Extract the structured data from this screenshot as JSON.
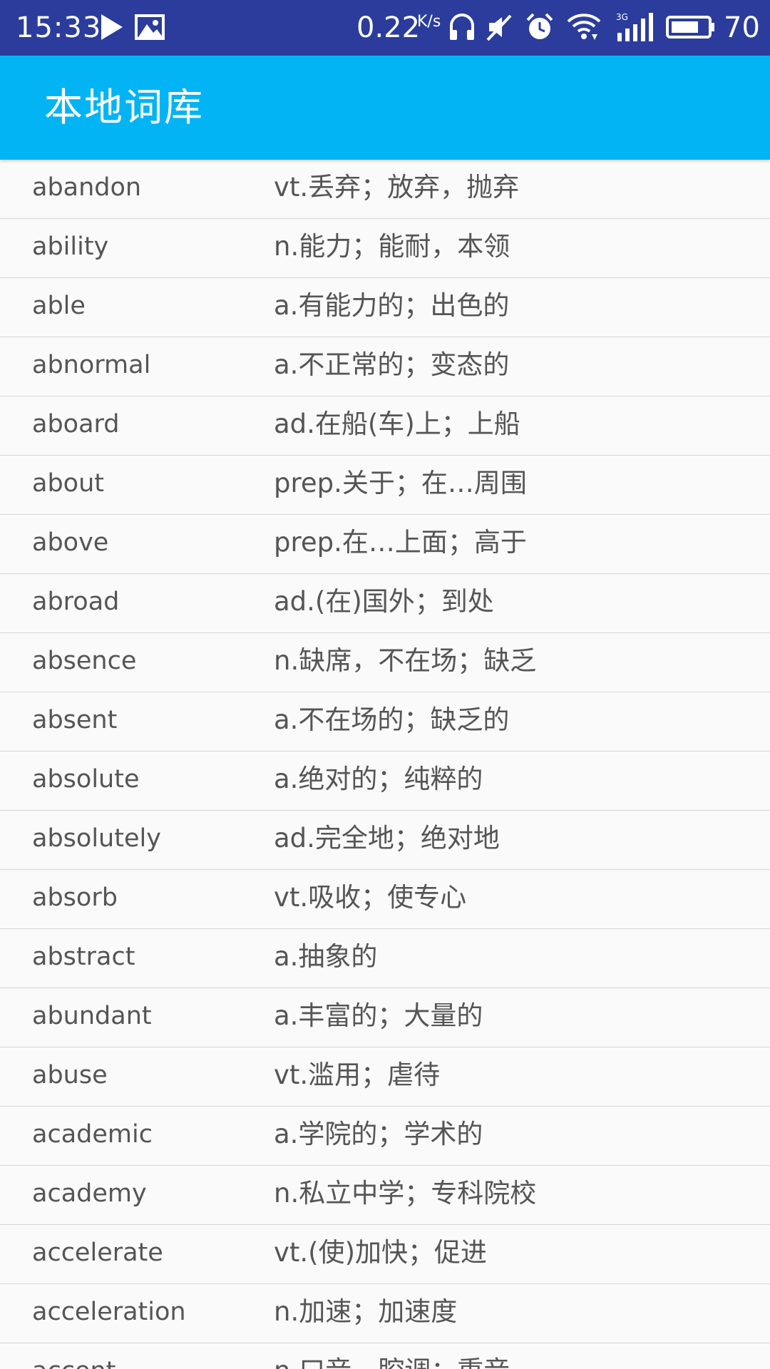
{
  "status_bar": {
    "time": "15:33",
    "speed": "0.22",
    "speed_unit": "K/s",
    "battery_level": "70",
    "icons": [
      "play-icon",
      "image-icon",
      "headset-icon",
      "mute-icon",
      "alarm-icon",
      "wifi-icon",
      "signal-3g-icon",
      "battery-icon"
    ]
  },
  "app_bar": {
    "title": "本地词库"
  },
  "colors": {
    "status_bar": "#2b3c9c",
    "app_bar": "#03b4f4",
    "background": "#fafafa",
    "text": "#555555",
    "divider": "#d6d6d6"
  },
  "words": [
    {
      "word": "abandon",
      "meaning": "vt.丢弃；放弃，抛弃"
    },
    {
      "word": "ability",
      "meaning": "n.能力；能耐，本领"
    },
    {
      "word": "able",
      "meaning": "a.有能力的；出色的"
    },
    {
      "word": "abnormal",
      "meaning": "a.不正常的；变态的"
    },
    {
      "word": "aboard",
      "meaning": "ad.在船(车)上；上船"
    },
    {
      "word": "about",
      "meaning": "prep.关于；在…周围"
    },
    {
      "word": "above",
      "meaning": "prep.在…上面；高于"
    },
    {
      "word": "abroad",
      "meaning": "ad.(在)国外；到处"
    },
    {
      "word": "absence",
      "meaning": "n.缺席，不在场；缺乏"
    },
    {
      "word": "absent",
      "meaning": "a.不在场的；缺乏的"
    },
    {
      "word": "absolute",
      "meaning": "a.绝对的；纯粹的"
    },
    {
      "word": "absolutely",
      "meaning": "ad.完全地；绝对地"
    },
    {
      "word": "absorb",
      "meaning": "vt.吸收；使专心"
    },
    {
      "word": "abstract",
      "meaning": "a.抽象的"
    },
    {
      "word": "abundant",
      "meaning": "a.丰富的；大量的"
    },
    {
      "word": "abuse",
      "meaning": "vt.滥用；虐待"
    },
    {
      "word": "academic",
      "meaning": "a.学院的；学术的"
    },
    {
      "word": "academy",
      "meaning": "n.私立中学；专科院校"
    },
    {
      "word": "accelerate",
      "meaning": "vt.(使)加快；促进"
    },
    {
      "word": "acceleration",
      "meaning": "n.加速；加速度"
    },
    {
      "word": "accent",
      "meaning": "n.口音，腔调；重音"
    }
  ]
}
